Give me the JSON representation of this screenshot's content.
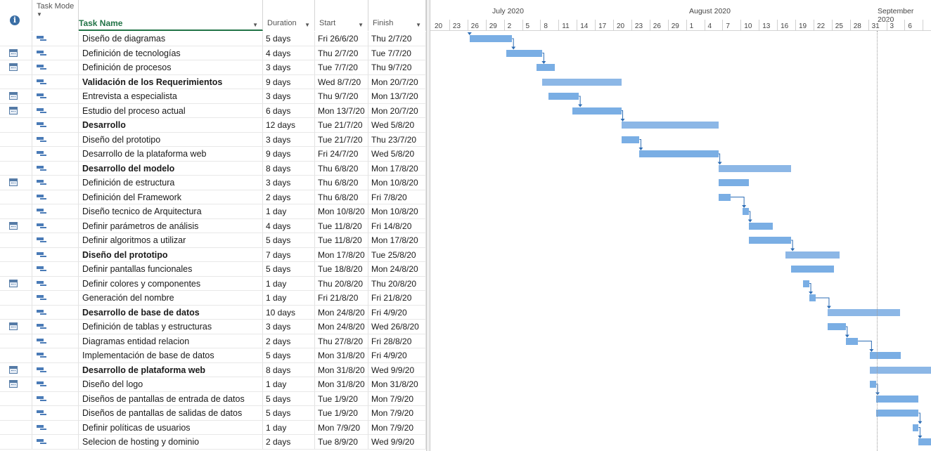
{
  "columns": {
    "mode": "Task Mode",
    "name": "Task Name",
    "duration": "Duration",
    "start": "Start",
    "finish": "Finish"
  },
  "timeline": {
    "months": [
      {
        "label": "July 2020"
      },
      {
        "label": "August 2020"
      },
      {
        "label": "September 2020"
      }
    ],
    "days": [
      "20",
      "23",
      "26",
      "29",
      "2",
      "5",
      "8",
      "11",
      "14",
      "17",
      "20",
      "23",
      "26",
      "29",
      "1",
      "4",
      "7",
      "10",
      "13",
      "16",
      "19",
      "22",
      "25",
      "28",
      "31",
      "3",
      "6"
    ]
  },
  "tasks": [
    {
      "name": "Diseño de diagramas",
      "duration": "5 days",
      "start": "Fri 26/6/20",
      "finish": "Thu 2/7/20",
      "summary": false,
      "cal": false
    },
    {
      "name": "Definición de tecnologías",
      "duration": "4 days",
      "start": "Thu 2/7/20",
      "finish": "Tue 7/7/20",
      "summary": false,
      "cal": true
    },
    {
      "name": "Definición de procesos",
      "duration": "3 days",
      "start": "Tue 7/7/20",
      "finish": "Thu 9/7/20",
      "summary": false,
      "cal": true
    },
    {
      "name": "Validación de los Requerimientos",
      "duration": "9 days",
      "start": "Wed 8/7/20",
      "finish": "Mon 20/7/20",
      "summary": true,
      "cal": false
    },
    {
      "name": "Entrevista a especialista",
      "duration": "3 days",
      "start": "Thu 9/7/20",
      "finish": "Mon 13/7/20",
      "summary": false,
      "cal": true
    },
    {
      "name": "Estudio del proceso actual",
      "duration": "6 days",
      "start": "Mon 13/7/20",
      "finish": "Mon 20/7/20",
      "summary": false,
      "cal": true
    },
    {
      "name": "Desarrollo",
      "duration": "12 days",
      "start": "Tue 21/7/20",
      "finish": "Wed 5/8/20",
      "summary": true,
      "cal": false
    },
    {
      "name": "Diseño del prototipo",
      "duration": "3 days",
      "start": "Tue 21/7/20",
      "finish": "Thu 23/7/20",
      "summary": false,
      "cal": false
    },
    {
      "name": "Desarrollo de la plataforma web",
      "duration": "9 days",
      "start": "Fri 24/7/20",
      "finish": "Wed 5/8/20",
      "summary": false,
      "cal": false
    },
    {
      "name": "Desarrollo del modelo",
      "duration": "8 days",
      "start": "Thu 6/8/20",
      "finish": "Mon 17/8/20",
      "summary": true,
      "cal": false
    },
    {
      "name": "Definición de estructura",
      "duration": "3 days",
      "start": "Thu 6/8/20",
      "finish": "Mon 10/8/20",
      "summary": false,
      "cal": true
    },
    {
      "name": "Definición del Framework",
      "duration": "2 days",
      "start": "Thu 6/8/20",
      "finish": "Fri 7/8/20",
      "summary": false,
      "cal": false
    },
    {
      "name": "Diseño tecnico de Arquitectura",
      "duration": "1 day",
      "start": "Mon 10/8/20",
      "finish": "Mon 10/8/20",
      "summary": false,
      "cal": false
    },
    {
      "name": "Definir parámetros de análisis",
      "duration": "4 days",
      "start": "Tue 11/8/20",
      "finish": "Fri 14/8/20",
      "summary": false,
      "cal": true
    },
    {
      "name": "Definir algoritmos a utilizar",
      "duration": "5 days",
      "start": "Tue 11/8/20",
      "finish": "Mon 17/8/20",
      "summary": false,
      "cal": false
    },
    {
      "name": "Diseño del prototipo",
      "duration": "7 days",
      "start": "Mon 17/8/20",
      "finish": "Tue 25/8/20",
      "summary": true,
      "cal": false
    },
    {
      "name": "Definir pantallas funcionales",
      "duration": "5 days",
      "start": "Tue 18/8/20",
      "finish": "Mon 24/8/20",
      "summary": false,
      "cal": false
    },
    {
      "name": "Definir colores y componentes",
      "duration": "1 day",
      "start": "Thu 20/8/20",
      "finish": "Thu 20/8/20",
      "summary": false,
      "cal": true
    },
    {
      "name": "Generación del nombre",
      "duration": "1 day",
      "start": "Fri 21/8/20",
      "finish": "Fri 21/8/20",
      "summary": false,
      "cal": false
    },
    {
      "name": "Desarrollo de base de datos",
      "duration": "10 days",
      "start": "Mon 24/8/20",
      "finish": "Fri 4/9/20",
      "summary": true,
      "cal": false
    },
    {
      "name": "Definición de tablas y estructuras",
      "duration": "3 days",
      "start": "Mon 24/8/20",
      "finish": "Wed 26/8/20",
      "summary": false,
      "cal": true
    },
    {
      "name": "Diagramas entidad relacion",
      "duration": "2 days",
      "start": "Thu 27/8/20",
      "finish": "Fri 28/8/20",
      "summary": false,
      "cal": false
    },
    {
      "name": "Implementación de base de datos",
      "duration": "5 days",
      "start": "Mon 31/8/20",
      "finish": "Fri 4/9/20",
      "summary": false,
      "cal": false
    },
    {
      "name": "Desarrollo de plataforma web",
      "duration": "8 days",
      "start": "Mon 31/8/20",
      "finish": "Wed 9/9/20",
      "summary": true,
      "cal": true
    },
    {
      "name": "Diseño del logo",
      "duration": "1 day",
      "start": "Mon 31/8/20",
      "finish": "Mon 31/8/20",
      "summary": false,
      "cal": true
    },
    {
      "name": "Diseños de pantallas de entrada de datos",
      "duration": "5 days",
      "start": "Tue 1/9/20",
      "finish": "Mon 7/9/20",
      "summary": false,
      "cal": false
    },
    {
      "name": "Diseños de pantallas de salidas de datos",
      "duration": "5 days",
      "start": "Tue 1/9/20",
      "finish": "Mon 7/9/20",
      "summary": false,
      "cal": false
    },
    {
      "name": "Definir políticas de usuarios",
      "duration": "1 day",
      "start": "Mon 7/9/20",
      "finish": "Mon 7/9/20",
      "summary": false,
      "cal": false
    },
    {
      "name": "Selecion de hosting y dominio",
      "duration": "2 days",
      "start": "Tue 8/9/20",
      "finish": "Wed 9/9/20",
      "summary": false,
      "cal": false
    }
  ]
}
